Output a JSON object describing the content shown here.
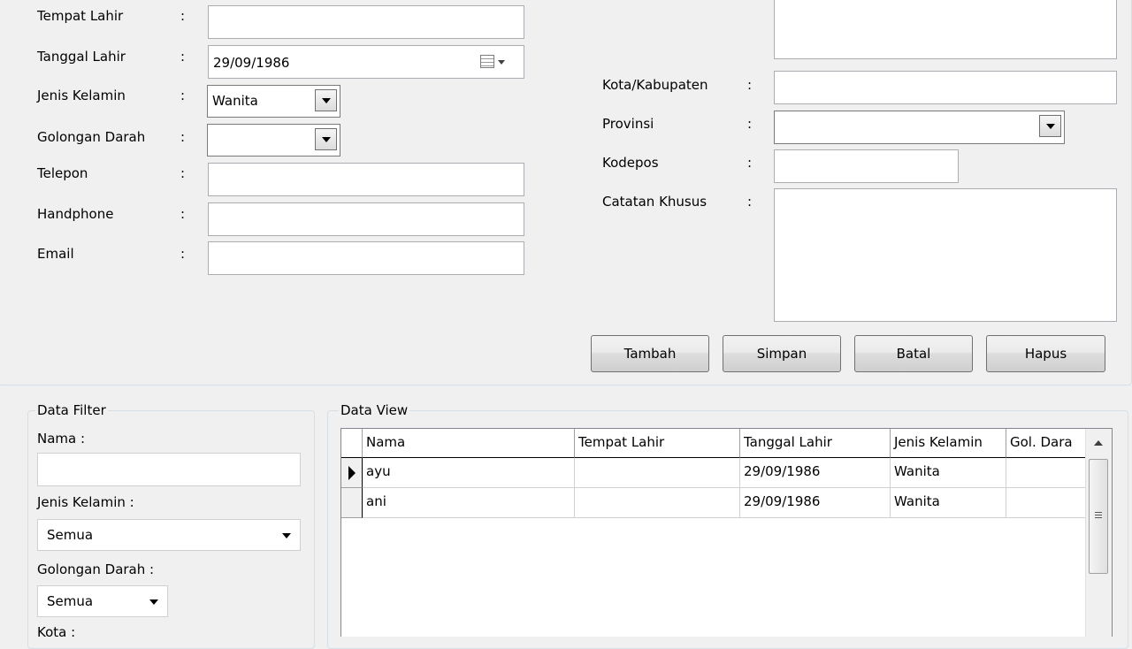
{
  "form": {
    "tempat_lahir": {
      "label": "Tempat Lahir",
      "value": ""
    },
    "tanggal_lahir": {
      "label": "Tanggal Lahir",
      "value": "29/09/1986"
    },
    "jenis_kelamin": {
      "label": "Jenis Kelamin",
      "value": "Wanita"
    },
    "golongan_darah": {
      "label": "Golongan Darah",
      "value": ""
    },
    "telepon": {
      "label": "Telepon",
      "value": ""
    },
    "handphone": {
      "label": "Handphone",
      "value": ""
    },
    "email": {
      "label": "Email",
      "value": ""
    },
    "kota": {
      "label": "Kota/Kabupaten",
      "value": ""
    },
    "provinsi": {
      "label": "Provinsi",
      "value": ""
    },
    "kodepos": {
      "label": "Kodepos",
      "value": ""
    },
    "catatan": {
      "label": "Catatan Khusus",
      "value": ""
    },
    "colon": ":"
  },
  "buttons": {
    "tambah": "Tambah",
    "simpan": "Simpan",
    "batal": "Batal",
    "hapus": "Hapus"
  },
  "filter": {
    "title": "Data Filter",
    "nama_label": "Nama :",
    "nama_value": "",
    "jenis_kelamin_label": "Jenis Kelamin :",
    "jenis_kelamin_value": "Semua",
    "golongan_darah_label": "Golongan Darah :",
    "golongan_darah_value": "Semua",
    "kota_label": "Kota :"
  },
  "dataview": {
    "title": "Data View",
    "columns": [
      "Nama",
      "Tempat Lahir",
      "Tanggal Lahir",
      "Jenis Kelamin",
      "Gol. Dara"
    ],
    "rows": [
      [
        "ayu",
        "",
        "29/09/1986",
        "Wanita",
        ""
      ],
      [
        "ani",
        "",
        "29/09/1986",
        "Wanita",
        ""
      ]
    ],
    "selected_row": 0
  }
}
